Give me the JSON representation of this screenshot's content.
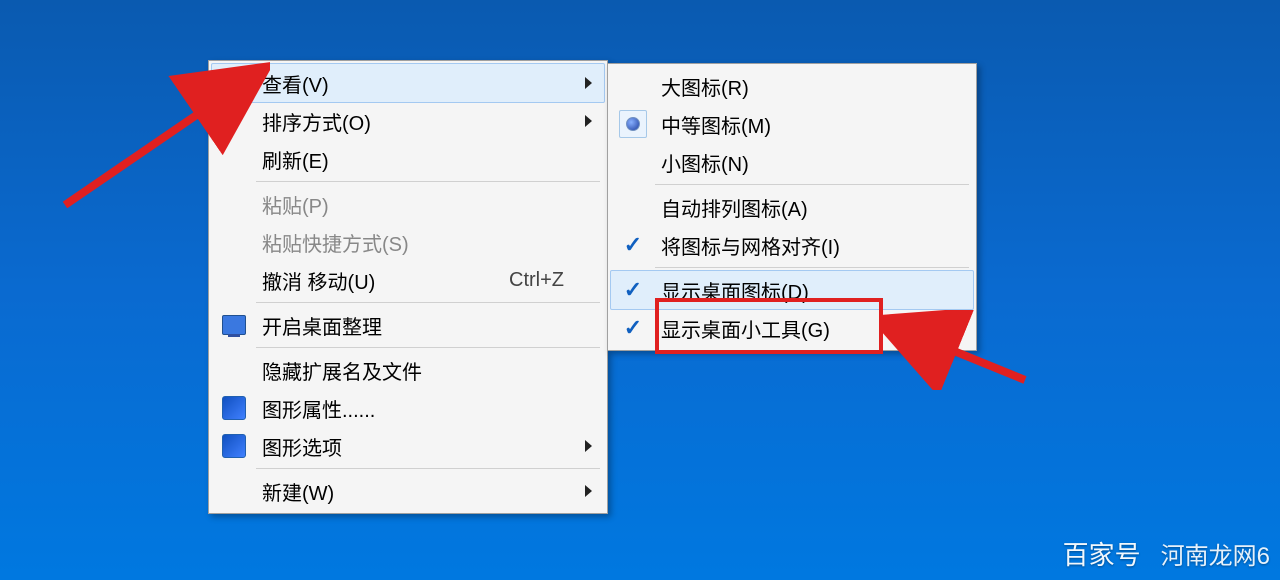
{
  "main_menu": {
    "items": [
      {
        "label": "查看(V)",
        "shortcut": "",
        "has_submenu": true,
        "disabled": false,
        "icon": "",
        "highlight": true
      },
      {
        "label": "排序方式(O)",
        "shortcut": "",
        "has_submenu": true,
        "disabled": false,
        "icon": ""
      },
      {
        "label": "刷新(E)",
        "shortcut": "",
        "has_submenu": false,
        "disabled": false,
        "icon": ""
      },
      {
        "sep": true
      },
      {
        "label": "粘贴(P)",
        "shortcut": "",
        "has_submenu": false,
        "disabled": true,
        "icon": ""
      },
      {
        "label": "粘贴快捷方式(S)",
        "shortcut": "",
        "has_submenu": false,
        "disabled": true,
        "icon": ""
      },
      {
        "label": "撤消 移动(U)",
        "shortcut": "Ctrl+Z",
        "has_submenu": false,
        "disabled": false,
        "icon": ""
      },
      {
        "sep": true
      },
      {
        "label": "开启桌面整理",
        "shortcut": "",
        "has_submenu": false,
        "disabled": false,
        "icon": "monitor"
      },
      {
        "sep": true
      },
      {
        "label": "隐藏扩展名及文件",
        "shortcut": "",
        "has_submenu": false,
        "disabled": false,
        "icon": ""
      },
      {
        "label": "图形属性......",
        "shortcut": "",
        "has_submenu": false,
        "disabled": false,
        "icon": "intel"
      },
      {
        "label": "图形选项",
        "shortcut": "",
        "has_submenu": true,
        "disabled": false,
        "icon": "intel"
      },
      {
        "sep": true
      },
      {
        "label": "新建(W)",
        "shortcut": "",
        "has_submenu": true,
        "disabled": false,
        "icon": ""
      }
    ]
  },
  "sub_menu": {
    "items": [
      {
        "label": "大图标(R)",
        "mark": ""
      },
      {
        "label": "中等图标(M)",
        "mark": "bullet"
      },
      {
        "label": "小图标(N)",
        "mark": ""
      },
      {
        "sep": true
      },
      {
        "label": "自动排列图标(A)",
        "mark": ""
      },
      {
        "label": "将图标与网格对齐(I)",
        "mark": "check"
      },
      {
        "sep": true
      },
      {
        "label": "显示桌面图标(D)",
        "mark": "check",
        "highlight": true
      },
      {
        "label": "显示桌面小工具(G)",
        "mark": "check"
      }
    ]
  },
  "watermark": {
    "left": "百家号",
    "right": "河南龙网6"
  }
}
